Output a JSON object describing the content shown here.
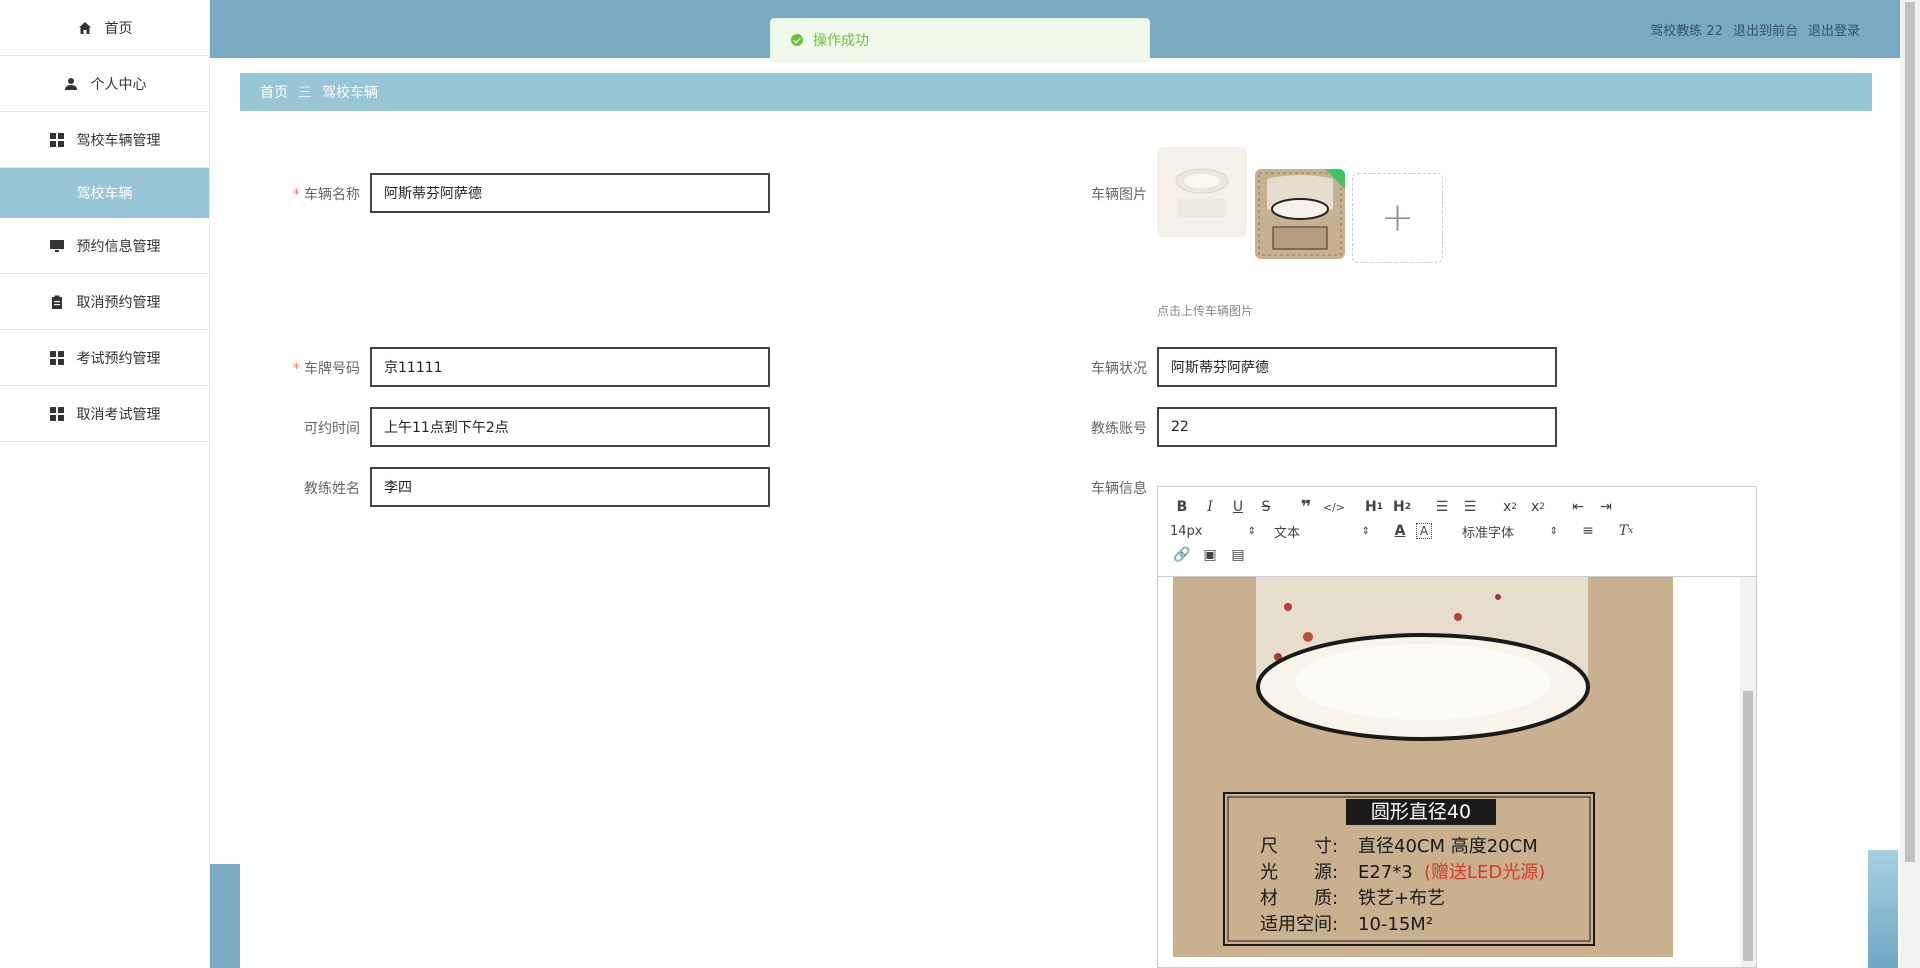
{
  "sidebar": {
    "items": [
      {
        "label": "首页",
        "icon": "home-icon"
      },
      {
        "label": "个人中心",
        "icon": "user-icon"
      },
      {
        "label": "驾校车辆管理",
        "icon": "grid-icon"
      },
      {
        "label": "驾校车辆",
        "icon": ""
      },
      {
        "label": "预约信息管理",
        "icon": "monitor-icon"
      },
      {
        "label": "取消预约管理",
        "icon": "clipboard-icon"
      },
      {
        "label": "考试预约管理",
        "icon": "grid-icon"
      },
      {
        "label": "取消考试管理",
        "icon": "grid-icon"
      }
    ]
  },
  "header": {
    "user": "驾校教练 22",
    "back_front": "退出到前台",
    "logout": "退出登录"
  },
  "toast": {
    "message": "操作成功"
  },
  "breadcrumb": {
    "home": "首页",
    "sep": "三",
    "current": "驾校车辆"
  },
  "form": {
    "car_name_label": "车辆名称",
    "car_name_value": "阿斯蒂芬阿萨德",
    "car_image_label": "车辆图片",
    "upload_hint": "点击上传车辆图片",
    "plate_label": "车牌号码",
    "plate_value": "京11111",
    "status_label": "车辆状况",
    "status_value": "阿斯蒂芬阿萨德",
    "time_label": "可约时间",
    "time_value": "上午11点到下午2点",
    "coach_account_label": "教练账号",
    "coach_account_value": "22",
    "coach_name_label": "教练姓名",
    "coach_name_value": "李四",
    "car_info_label": "车辆信息"
  },
  "editor": {
    "font_size": "14px",
    "block_type": "文本",
    "font_family": "标准字体",
    "image": {
      "heading": "圆形直径40",
      "lines": [
        {
          "key": "尺　　寸:",
          "value": "直径40CM 高度20CM",
          "extra": ""
        },
        {
          "key": "光　　源:",
          "value": "E27*3",
          "extra": "(赠送LED光源)"
        },
        {
          "key": "材　　质:",
          "value": "铁艺+布艺",
          "extra": ""
        },
        {
          "key": "适用空间:",
          "value": "10-15M²",
          "extra": ""
        }
      ]
    }
  },
  "colors": {
    "accent": "#99c6d6",
    "topbar": "#7aaac3",
    "success": "#67c23a",
    "required": "#f56c6c"
  }
}
